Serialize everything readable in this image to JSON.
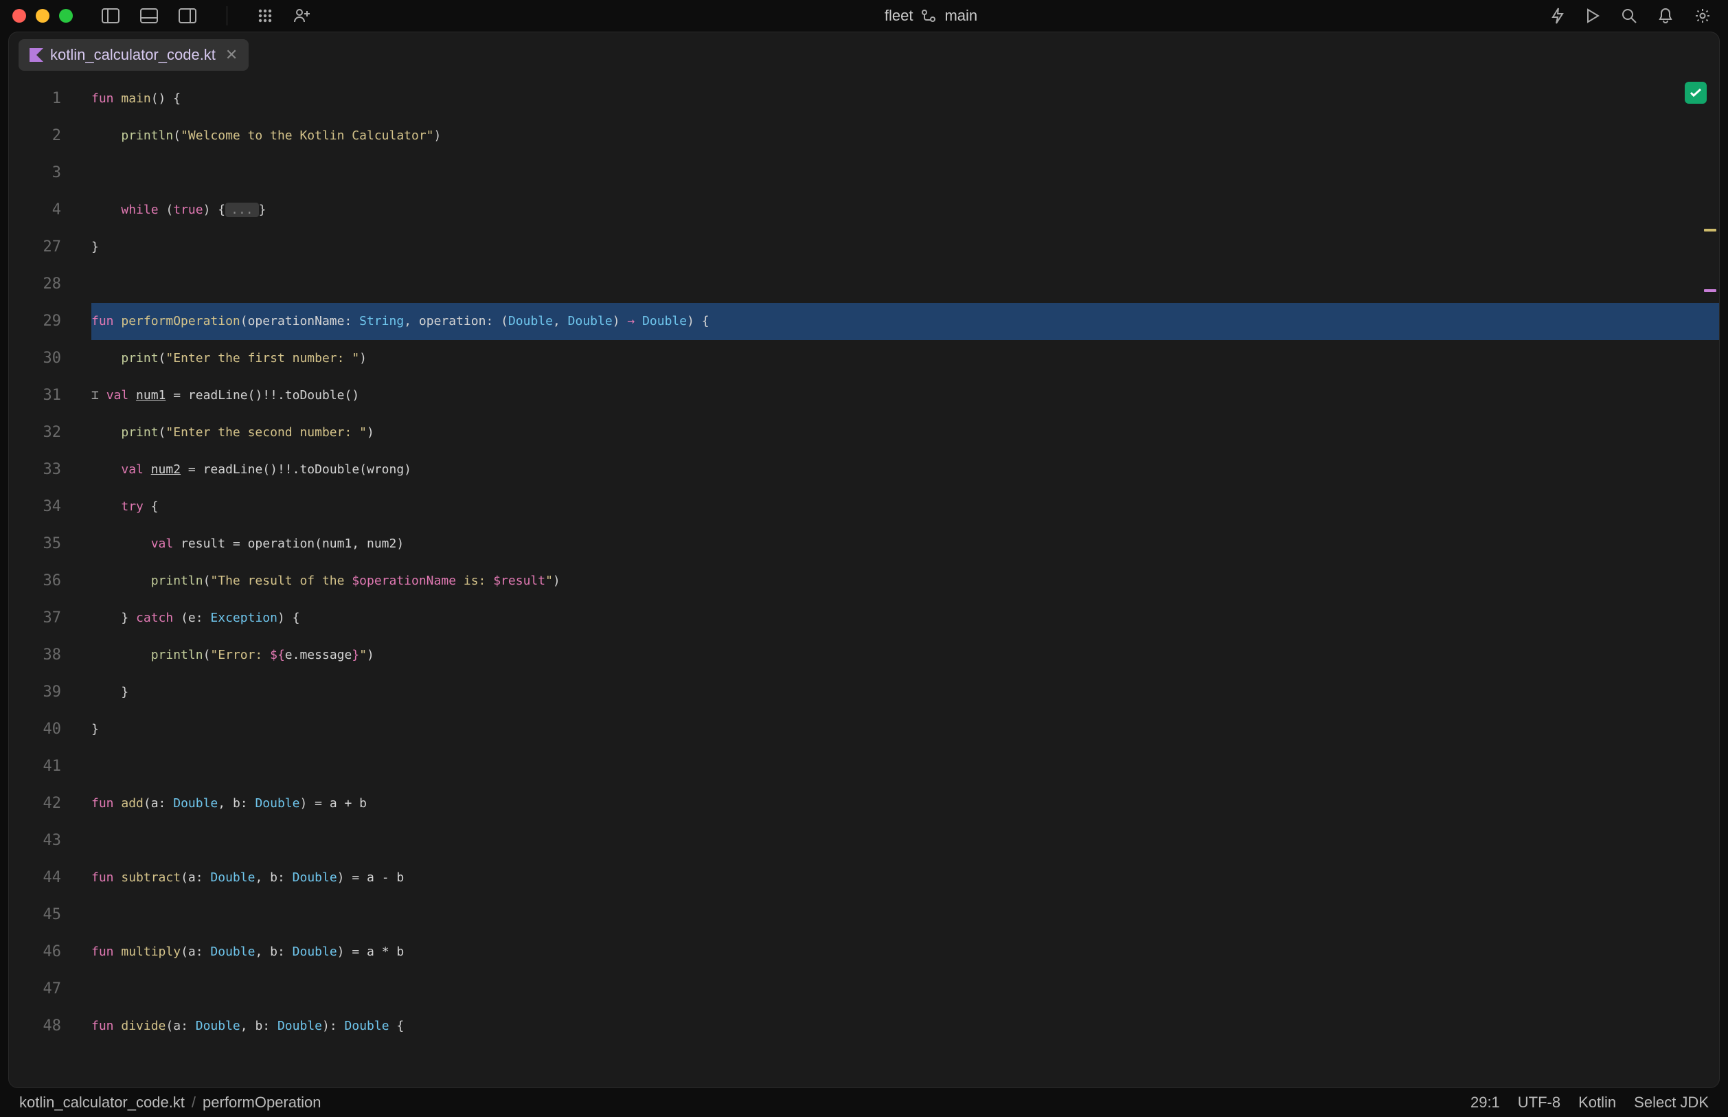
{
  "window": {
    "project": "fleet",
    "branch": "main"
  },
  "tab": {
    "name": "kotlin_calculator_code.kt"
  },
  "gutter": [
    "1",
    "2",
    "3",
    "4",
    "27",
    "28",
    "29",
    "30",
    "31",
    "32",
    "33",
    "34",
    "35",
    "36",
    "37",
    "38",
    "39",
    "40",
    "41",
    "42",
    "43",
    "44",
    "45",
    "46",
    "47",
    "48"
  ],
  "code": {
    "l1": {
      "a": "fun ",
      "b": "main",
      "c": "() {"
    },
    "l2": {
      "a": "    ",
      "b": "println",
      "c": "(",
      "d": "\"Welcome to the Kotlin Calculator\"",
      "e": ")"
    },
    "l3": "",
    "l4": {
      "a": "    ",
      "b": "while ",
      "c": "(",
      "d": "true",
      "e": ") {",
      "f": "...",
      "g": "}"
    },
    "l5": "}",
    "l6": "",
    "l7": {
      "a": "fun ",
      "b": "performOperation",
      "c": "(",
      "d": "operationName",
      "e": ": ",
      "f": "String",
      "g": ", ",
      "h": "operation",
      "i": ": (",
      "j": "Double",
      "k": ", ",
      "l": "Double",
      "m": ") ",
      "n": "→",
      "o": " ",
      "p": "Double",
      "q": ") {"
    },
    "l8": {
      "a": "    ",
      "b": "print",
      "c": "(",
      "d": "\"Enter the first number: \"",
      "e": ")"
    },
    "l9": {
      "a": "    ",
      "b": "val ",
      "c": "num1",
      "d": " = readLine()!!.toDouble()"
    },
    "l10": {
      "a": "    ",
      "b": "print",
      "c": "(",
      "d": "\"Enter the second number: \"",
      "e": ")"
    },
    "l11": {
      "a": "    ",
      "b": "val ",
      "c": "num2",
      "d": " = readLine()!!.toDouble(wrong)"
    },
    "l12": {
      "a": "    ",
      "b": "try ",
      "c": "{"
    },
    "l13": {
      "a": "        ",
      "b": "val ",
      "c": "result = operation(num1, num2)"
    },
    "l14": {
      "a": "        ",
      "b": "println",
      "c": "(",
      "d": "\"The result of the ",
      "e": "$operationName",
      "f": " is: ",
      "g": "$result",
      "h": "\"",
      "i": ")"
    },
    "l15": {
      "a": "    } ",
      "b": "catch ",
      "c": "(e: ",
      "d": "Exception",
      "e": ") {"
    },
    "l16": {
      "a": "        ",
      "b": "println",
      "c": "(",
      "d": "\"Error: ",
      "e": "${",
      "f": "e.message",
      "g": "}",
      "h": "\"",
      "i": ")"
    },
    "l17": "    }",
    "l18": "}",
    "l19": "",
    "l20": {
      "a": "fun ",
      "b": "add",
      "c": "(a: ",
      "d": "Double",
      "e": ", b: ",
      "f": "Double",
      "g": ") = a + b"
    },
    "l21": "",
    "l22": {
      "a": "fun ",
      "b": "subtract",
      "c": "(a: ",
      "d": "Double",
      "e": ", b: ",
      "f": "Double",
      "g": ") = a - b"
    },
    "l23": "",
    "l24": {
      "a": "fun ",
      "b": "multiply",
      "c": "(a: ",
      "d": "Double",
      "e": ", b: ",
      "f": "Double",
      "g": ") = a * b"
    },
    "l25": "",
    "l26": {
      "a": "fun ",
      "b": "divide",
      "c": "(a: ",
      "d": "Double",
      "e": ", b: ",
      "f": "Double",
      "g": "): ",
      "h": "Double",
      "i": " {"
    }
  },
  "status": {
    "file": "kotlin_calculator_code.kt",
    "func": "performOperation",
    "pos": "29:1",
    "enc": "UTF-8",
    "lang": "Kotlin",
    "jdk": "Select JDK"
  }
}
